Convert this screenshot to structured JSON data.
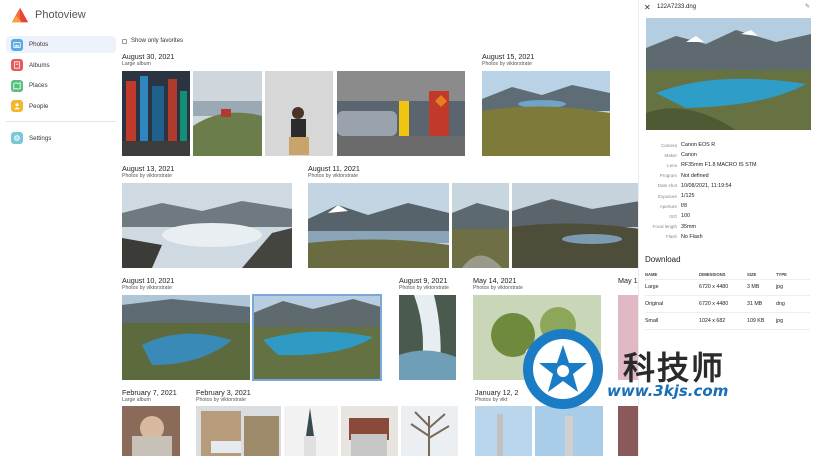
{
  "app": {
    "name": "Photoview"
  },
  "sidebar": {
    "items": [
      {
        "label": "Photos",
        "icon": "photos-icon",
        "color": "#58a9e6",
        "active": true
      },
      {
        "label": "Albums",
        "icon": "albums-icon",
        "color": "#e85a5a",
        "active": false
      },
      {
        "label": "Places",
        "icon": "places-icon",
        "color": "#57c07c",
        "active": false
      },
      {
        "label": "People",
        "icon": "people-icon",
        "color": "#f2b82b",
        "active": false
      }
    ],
    "settings": {
      "label": "Settings",
      "icon": "gear-icon",
      "color": "#7bc6d9"
    }
  },
  "main": {
    "favorites_label": "Show only favorites",
    "groups": [
      {
        "date": "August 30, 2021",
        "album": "Large album"
      },
      {
        "date": "August 15, 2021",
        "album": "Photos by viktorstrate"
      },
      {
        "date": "August 13, 2021",
        "album": "Photos by viktorstrate"
      },
      {
        "date": "August 11, 2021",
        "album": "Photos by viktorstrate"
      },
      {
        "date": "August 10, 2021",
        "album": "Photos by viktorstrate"
      },
      {
        "date": "August 9, 2021",
        "album": "Photos by viktorstrate"
      },
      {
        "date": "May 14, 2021",
        "album": "Photos by viktorstrate"
      },
      {
        "date": "May 1",
        "album": ""
      },
      {
        "date": "February 7, 2021",
        "album": "Large album"
      },
      {
        "date": "February 3, 2021",
        "album": "Photos by viktorstrate"
      },
      {
        "date": "January 12, 2",
        "album": "Photos by vikt"
      }
    ]
  },
  "panel": {
    "filename": "122A7233.dng",
    "exif": [
      {
        "key": "Camera",
        "value": "Canon EOS R"
      },
      {
        "key": "Maker",
        "value": "Canon"
      },
      {
        "key": "Lens",
        "value": "RF35mm F1.8 MACRO IS STM"
      },
      {
        "key": "Program",
        "value": "Not defined"
      },
      {
        "key": "Date shot",
        "value": "10/08/2021, 11:19:54"
      },
      {
        "key": "Exposure",
        "value": "1/125"
      },
      {
        "key": "Aperture",
        "value": "f/8"
      },
      {
        "key": "ISO",
        "value": "100"
      },
      {
        "key": "Focal length",
        "value": "35mm"
      },
      {
        "key": "Flash",
        "value": "No Flash"
      }
    ],
    "download": {
      "title": "Download",
      "headers": [
        "NAME",
        "DIMENSIONS",
        "SIZE",
        "TYPE"
      ],
      "rows": [
        [
          "Large",
          "6720 x 4480",
          "3 MB",
          "jpg"
        ],
        [
          "Original",
          "6720 x 4480",
          "31 MB",
          "dng"
        ],
        [
          "Small",
          "1024 x 682",
          "109 KB",
          "jpg"
        ]
      ]
    }
  },
  "watermark": {
    "title": "科技师",
    "url": "www.3kjs.com"
  }
}
